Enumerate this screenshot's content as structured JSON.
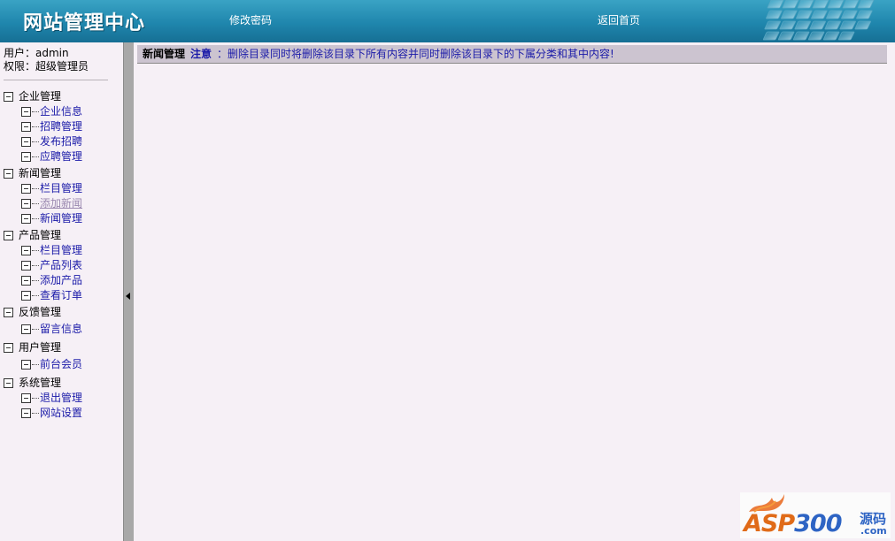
{
  "header": {
    "title": "网站管理中心",
    "change_password": "修改密码",
    "back_home": "返回首页"
  },
  "user": {
    "user_line": "用户：admin",
    "role_line": "权限：超级管理员"
  },
  "menu": [
    {
      "label": "企业管理",
      "children": [
        "企业信息",
        "招聘管理",
        "发布招聘",
        "应聘管理"
      ]
    },
    {
      "label": "新闻管理",
      "children": [
        "栏目管理",
        "添加新闻",
        "新闻管理"
      ]
    },
    {
      "label": "产品管理",
      "children": [
        "栏目管理",
        "产品列表",
        "添加产品",
        "查看订单"
      ]
    },
    {
      "label": "反馈管理",
      "children": [
        "留言信息"
      ]
    },
    {
      "label": "用户管理",
      "children": [
        "前台会员"
      ]
    },
    {
      "label": "系统管理",
      "children": [
        "退出管理",
        "网站设置"
      ]
    }
  ],
  "notice": {
    "section": "新闻管理",
    "warning_label": "注意",
    "message": "：删除目录同时将删除该目录下所有内容并同时删除该目录下的下属分类和其中内容!"
  },
  "watermark": {
    "brand_a": "ASP",
    "brand_b": "300",
    "cn": "源码",
    "com": ".com"
  },
  "colors": {
    "header_bg": "#1f86ad",
    "link": "#1a1aa8",
    "visited_link": "#9a88b0",
    "page_bg": "#f6f0f6"
  }
}
